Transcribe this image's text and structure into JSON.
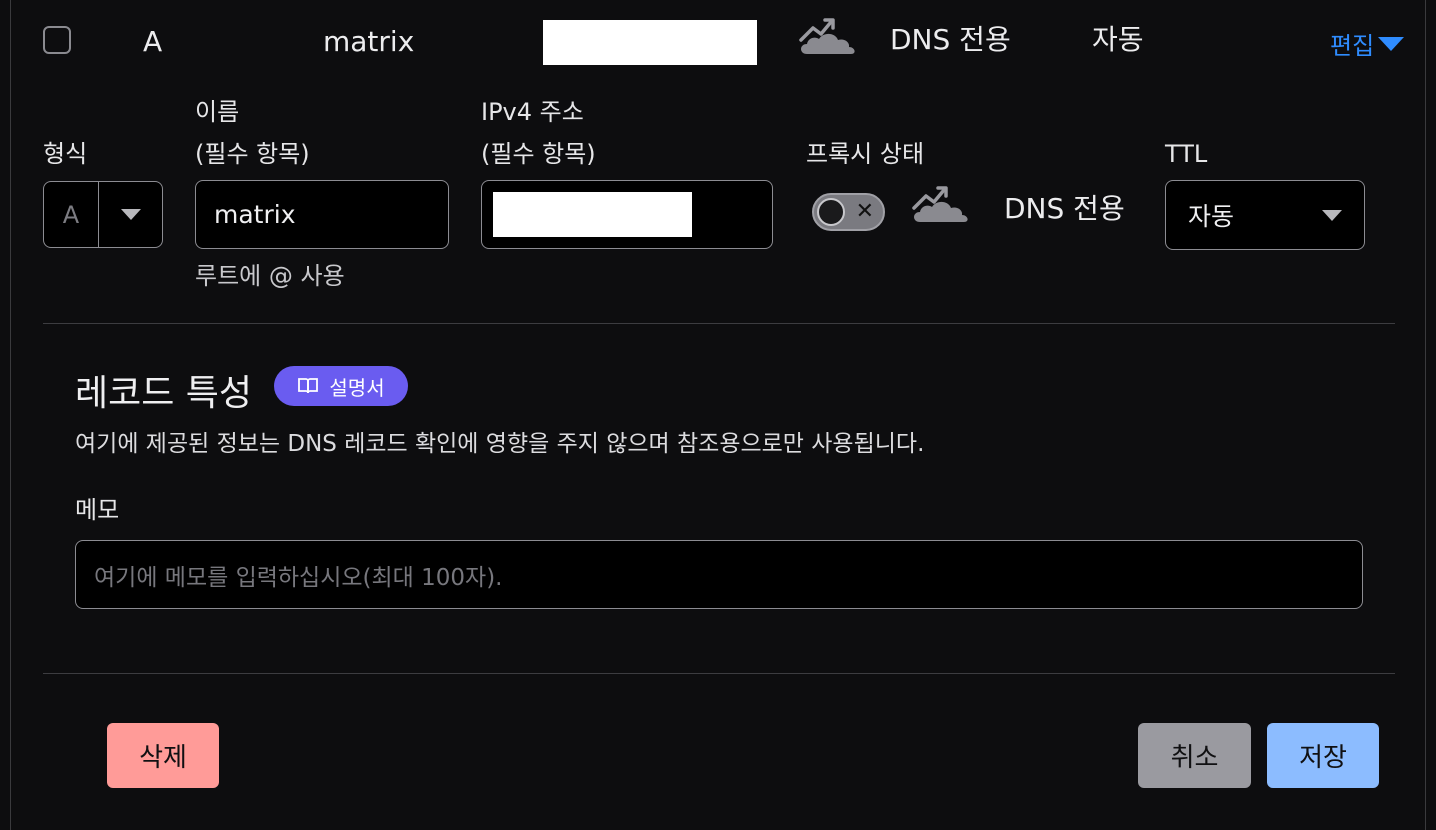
{
  "summary_row": {
    "type": "A",
    "name": "matrix",
    "proxy_status": "DNS 전용",
    "ttl": "자동",
    "edit_label": "편집"
  },
  "form": {
    "type_label": "형식",
    "type_value": "A",
    "name_label_line1": "이름",
    "name_label_line2": "(필수 항목)",
    "name_value": "matrix",
    "name_hint": "루트에 @ 사용",
    "ipv4_label_line1": "IPv4 주소",
    "ipv4_label_line2": "(필수 항목)",
    "proxy_label": "프록시 상태",
    "proxy_on": false,
    "proxy_status": "DNS 전용",
    "ttl_label": "TTL",
    "ttl_value": "자동"
  },
  "record_attributes": {
    "title": "레코드 특성",
    "doc_badge": "설명서",
    "description": "여기에 제공된 정보는 DNS 레코드 확인에 영향을 주지 않으며 참조용으로만 사용됩니다.",
    "memo_label": "메모",
    "memo_placeholder": "여기에 메모를 입력하십시오(최대 100자)."
  },
  "buttons": {
    "delete": "삭제",
    "cancel": "취소",
    "save": "저장"
  },
  "colors": {
    "accent_blue": "#2f8cff",
    "badge_purple": "#6a5cf0",
    "delete": "#ff9b98",
    "cancel": "#9a9aa0",
    "save": "#8cbcff"
  },
  "icons": {
    "cloud": "cloud-dns-only-icon",
    "doc": "book-icon"
  }
}
